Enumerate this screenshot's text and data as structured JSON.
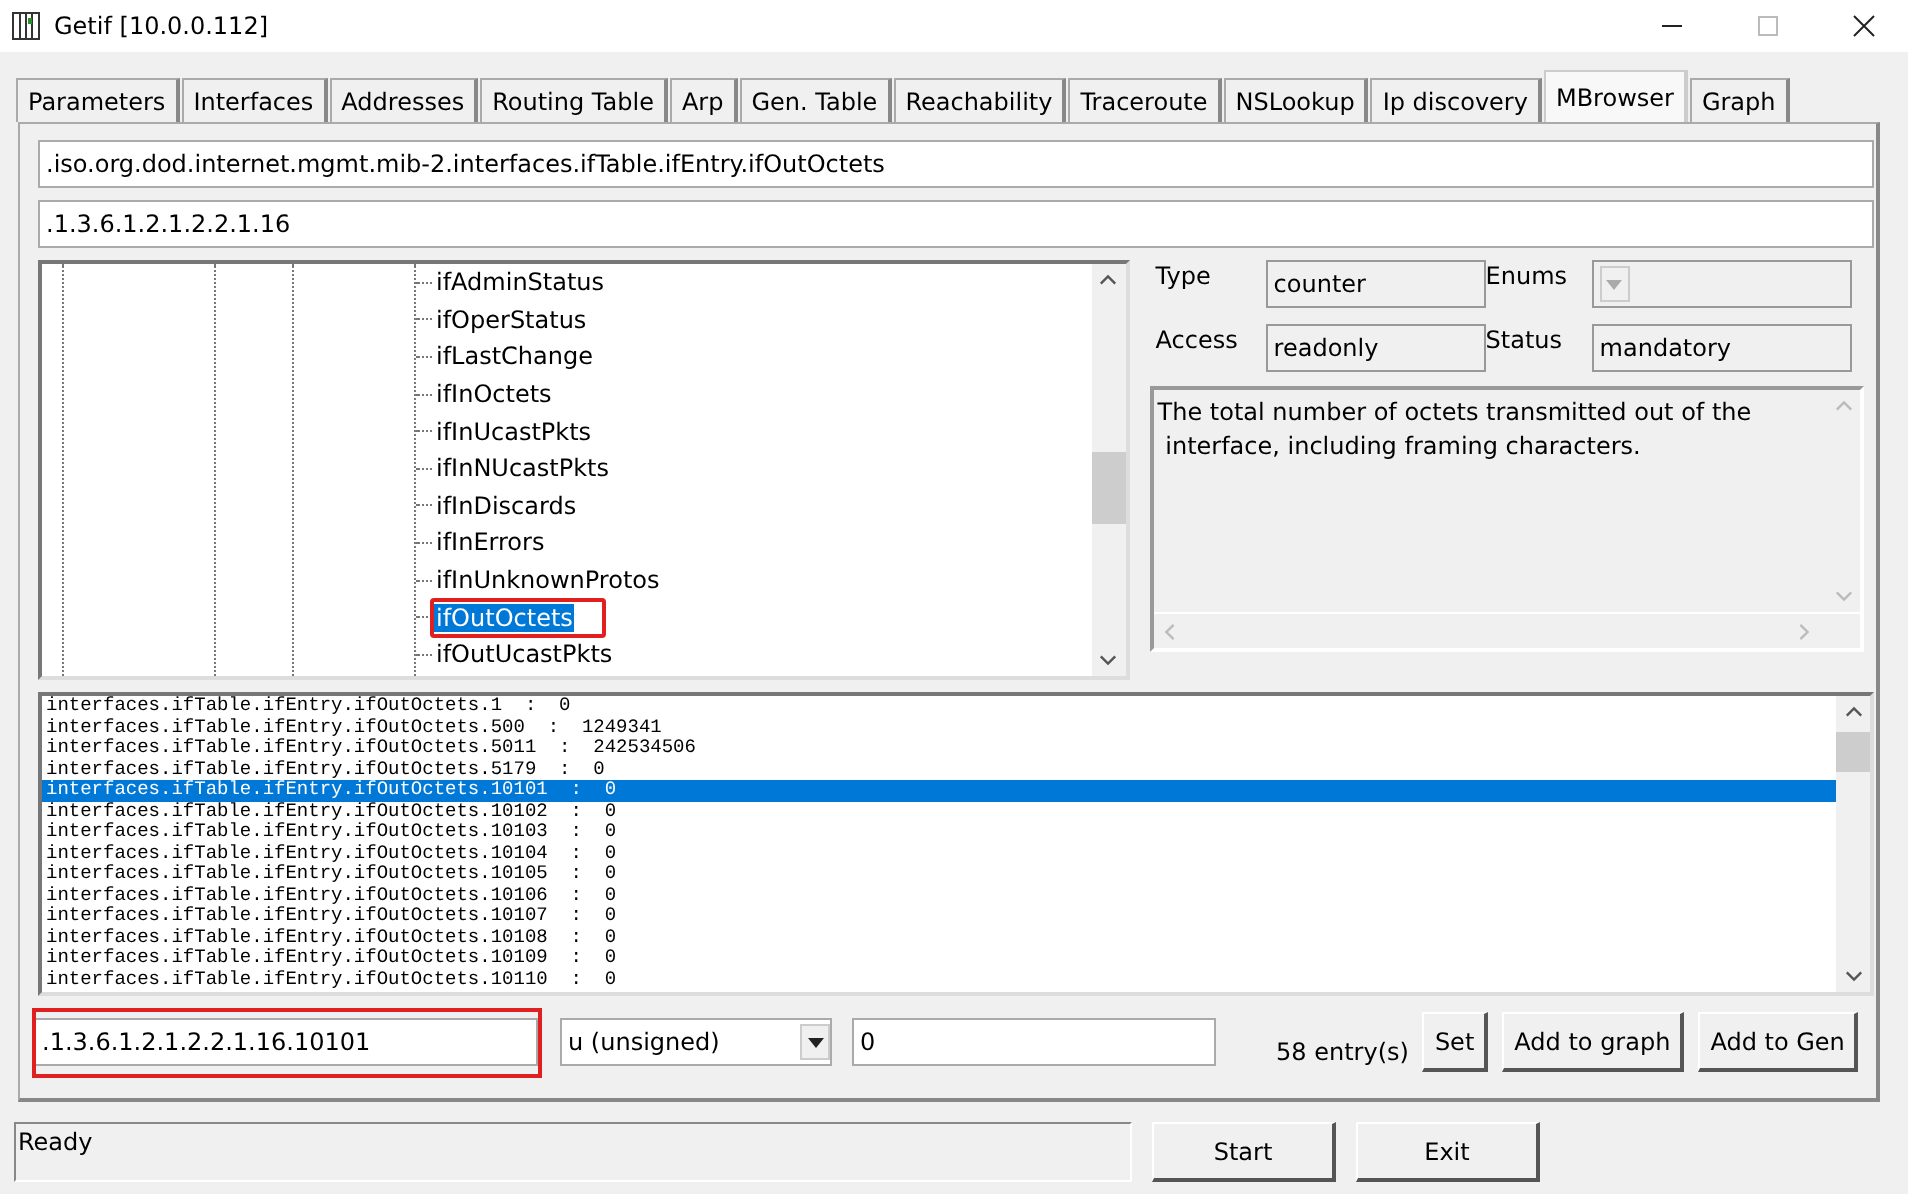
{
  "window": {
    "title": "Getif [10.0.0.112]"
  },
  "tabs": [
    {
      "label": "Parameters",
      "selected": false
    },
    {
      "label": "Interfaces",
      "selected": false
    },
    {
      "label": "Addresses",
      "selected": false
    },
    {
      "label": "Routing Table",
      "selected": false
    },
    {
      "label": "Arp",
      "selected": false
    },
    {
      "label": "Gen. Table",
      "selected": false
    },
    {
      "label": "Reachability",
      "selected": false
    },
    {
      "label": "Traceroute",
      "selected": false
    },
    {
      "label": "NSLookup",
      "selected": false
    },
    {
      "label": "Ip discovery",
      "selected": false
    },
    {
      "label": "MBrowser",
      "selected": true
    },
    {
      "label": "Graph",
      "selected": false
    }
  ],
  "oid_name": ".iso.org.dod.internet.mgmt.mib-2.interfaces.ifTable.ifEntry.ifOutOctets",
  "oid_number": ".1.3.6.1.2.1.2.2.1.16",
  "tree": {
    "items": [
      {
        "label": "ifAdminStatus",
        "selected": false,
        "highlighted": false
      },
      {
        "label": "ifOperStatus",
        "selected": false,
        "highlighted": false
      },
      {
        "label": "ifLastChange",
        "selected": false,
        "highlighted": false
      },
      {
        "label": "ifInOctets",
        "selected": false,
        "highlighted": false
      },
      {
        "label": "ifInUcastPkts",
        "selected": false,
        "highlighted": false
      },
      {
        "label": "ifInNUcastPkts",
        "selected": false,
        "highlighted": false
      },
      {
        "label": "ifInDiscards",
        "selected": false,
        "highlighted": false
      },
      {
        "label": "ifInErrors",
        "selected": false,
        "highlighted": false
      },
      {
        "label": "ifInUnknownProtos",
        "selected": false,
        "highlighted": false
      },
      {
        "label": "ifOutOctets",
        "selected": true,
        "highlighted": true
      },
      {
        "label": "ifOutUcastPkts",
        "selected": false,
        "highlighted": false
      }
    ]
  },
  "details": {
    "type_label": "Type",
    "type_value": "counter",
    "enums_label": "Enums",
    "access_label": "Access",
    "access_value": "readonly",
    "status_label": "Status",
    "status_value": "mandatory",
    "description": "The total number of octets transmitted out of the\n interface, including framing characters."
  },
  "results": [
    {
      "text": "interfaces.ifTable.ifEntry.ifOutOctets.1  :  0",
      "selected": false
    },
    {
      "text": "interfaces.ifTable.ifEntry.ifOutOctets.500  :  1249341",
      "selected": false
    },
    {
      "text": "interfaces.ifTable.ifEntry.ifOutOctets.5011  :  242534506",
      "selected": false
    },
    {
      "text": "interfaces.ifTable.ifEntry.ifOutOctets.5179  :  0",
      "selected": false
    },
    {
      "text": "interfaces.ifTable.ifEntry.ifOutOctets.10101  :  0",
      "selected": true
    },
    {
      "text": "interfaces.ifTable.ifEntry.ifOutOctets.10102  :  0",
      "selected": false
    },
    {
      "text": "interfaces.ifTable.ifEntry.ifOutOctets.10103  :  0",
      "selected": false
    },
    {
      "text": "interfaces.ifTable.ifEntry.ifOutOctets.10104  :  0",
      "selected": false
    },
    {
      "text": "interfaces.ifTable.ifEntry.ifOutOctets.10105  :  0",
      "selected": false
    },
    {
      "text": "interfaces.ifTable.ifEntry.ifOutOctets.10106  :  0",
      "selected": false
    },
    {
      "text": "interfaces.ifTable.ifEntry.ifOutOctets.10107  :  0",
      "selected": false
    },
    {
      "text": "interfaces.ifTable.ifEntry.ifOutOctets.10108  :  0",
      "selected": false
    },
    {
      "text": "interfaces.ifTable.ifEntry.ifOutOctets.10109  :  0",
      "selected": false
    },
    {
      "text": "interfaces.ifTable.ifEntry.ifOutOctets.10110  :  0",
      "selected": false
    }
  ],
  "set_row": {
    "oid": ".1.3.6.1.2.1.2.2.1.16.10101",
    "oid_highlighted": true,
    "value_type": "u (unsigned)",
    "value": "0",
    "entry_count": "58 entry(s)",
    "buttons": [
      "Set",
      "Add to graph",
      "Add to Gen"
    ]
  },
  "status_bar": {
    "text": "Ready"
  },
  "actions": [
    "Start",
    "Exit"
  ]
}
